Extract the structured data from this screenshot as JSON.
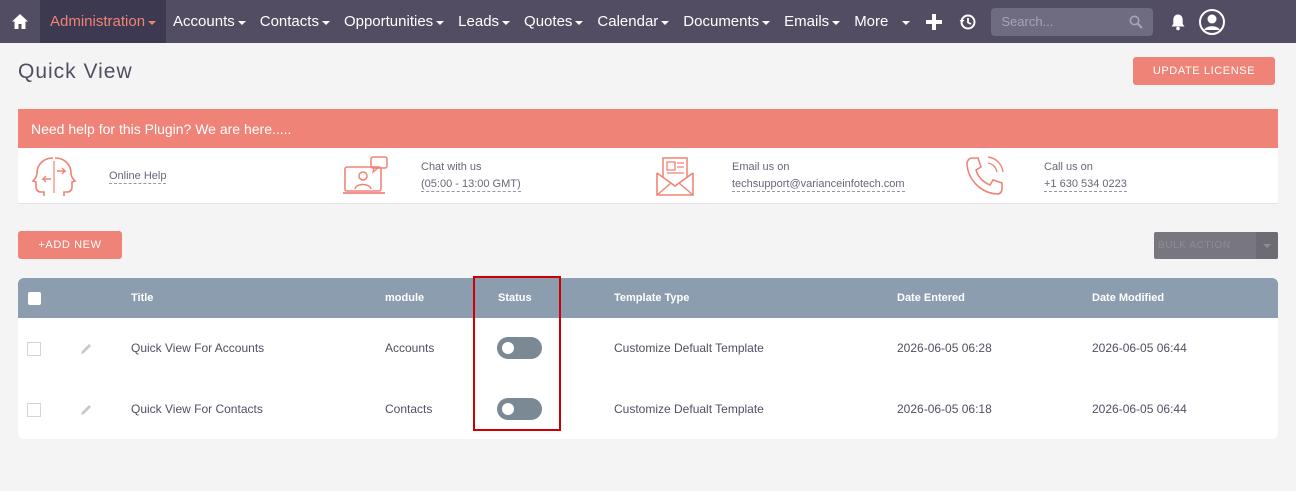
{
  "nav": {
    "active": "Administration",
    "items": [
      "Accounts",
      "Contacts",
      "Opportunities",
      "Leads",
      "Quotes",
      "Calendar",
      "Documents",
      "Emails",
      "More"
    ],
    "search_placeholder": "Search..."
  },
  "page": {
    "title": "Quick View",
    "update_license": "UPDATE LICENSE"
  },
  "help": {
    "header": "Need help for this Plugin? We are here.....",
    "online_help": "Online Help",
    "chat_label": "Chat with us",
    "chat_hours": "(05:00 - 13:00 GMT)",
    "email_label": "Email us on",
    "email_address": "techsupport@varianceinfotech.com",
    "call_label": "Call us on",
    "call_number": "+1 630 534 0223"
  },
  "actions": {
    "add_new": "+ADD NEW",
    "bulk_action": "BULK ACTION"
  },
  "table": {
    "columns": [
      "Title",
      "module",
      "Status",
      "Template Type",
      "Date Entered",
      "Date Modified"
    ],
    "rows": [
      {
        "title": "Quick View For Accounts",
        "module": "Accounts",
        "status": "off",
        "template_type": "Customize Defualt Template",
        "date_entered": "2026-06-05 06:28",
        "date_modified": "2026-06-05 06:44"
      },
      {
        "title": "Quick View For Contacts",
        "module": "Contacts",
        "status": "off",
        "template_type": "Customize Defualt Template",
        "date_entered": "2026-06-05 06:18",
        "date_modified": "2026-06-05 06:44"
      }
    ]
  },
  "colors": {
    "nav_bg": "#534d64",
    "accent": "#f08377",
    "table_header": "#8d9db0",
    "toggle_off": "#7b8995",
    "highlight": "#cc0000"
  }
}
